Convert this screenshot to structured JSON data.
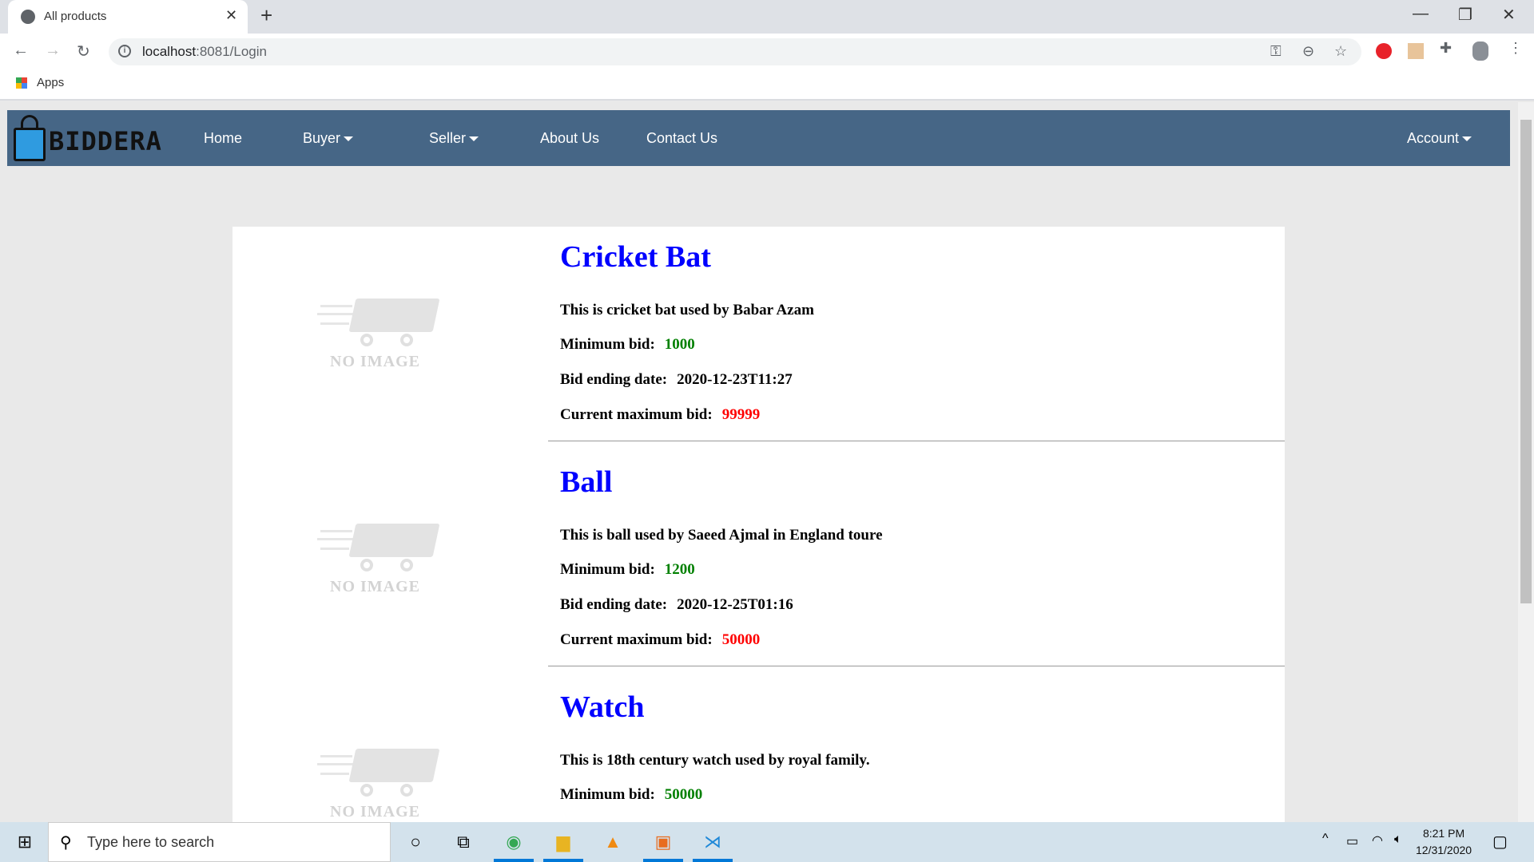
{
  "browser": {
    "tab_title": "All products",
    "url_host": "localhost",
    "url_path": ":8081/Login",
    "bookmark": "Apps"
  },
  "nav": {
    "logo": "BIDDERA",
    "links": [
      "Home",
      "Buyer",
      "Seller",
      "About Us",
      "Contact Us"
    ],
    "account": "Account"
  },
  "labels": {
    "min_bid": "Minimum bid:",
    "end_date": "Bid ending date:",
    "max_bid": "Current maximum bid:",
    "no_image": "NO IMAGE"
  },
  "products": [
    {
      "title": "Cricket Bat",
      "description": "This is cricket bat used by Babar Azam",
      "min_bid": "1000",
      "end_date": "2020-12-23T11:27",
      "max_bid": "99999"
    },
    {
      "title": "Ball",
      "description": "This is ball used by Saeed Ajmal in England toure",
      "min_bid": "1200",
      "end_date": "2020-12-25T01:16",
      "max_bid": "50000"
    },
    {
      "title": "Watch",
      "description": "This is 18th century watch used by royal family.",
      "min_bid": "50000"
    }
  ],
  "taskbar": {
    "search_placeholder": "Type here to search",
    "time": "8:21 PM",
    "date": "12/31/2020"
  },
  "colors": {
    "navbar": "#466686",
    "title": "#0000ff",
    "min_bid": "#008000",
    "max_bid": "#ff0000"
  }
}
